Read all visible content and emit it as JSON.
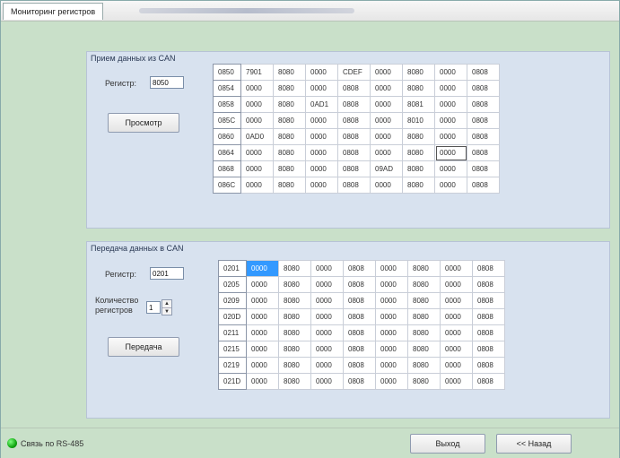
{
  "window": {
    "title": "Мониторинг регистров"
  },
  "receive": {
    "caption": "Прием данных из CAN",
    "register_label": "Регистр:",
    "register_value": "8050",
    "view_button": "Просмотр",
    "rows": [
      {
        "addr": "0850",
        "cells": [
          "7901",
          "8080",
          "0000",
          "CDEF",
          "0000",
          "8080",
          "0000",
          "0808"
        ]
      },
      {
        "addr": "0854",
        "cells": [
          "0000",
          "8080",
          "0000",
          "0808",
          "0000",
          "8080",
          "0000",
          "0808"
        ]
      },
      {
        "addr": "0858",
        "cells": [
          "0000",
          "8080",
          "0AD1",
          "0808",
          "0000",
          "8081",
          "0000",
          "0808"
        ]
      },
      {
        "addr": "085C",
        "cells": [
          "0000",
          "8080",
          "0000",
          "0808",
          "0000",
          "8010",
          "0000",
          "0808"
        ]
      },
      {
        "addr": "0860",
        "cells": [
          "0AD0",
          "8080",
          "0000",
          "0808",
          "0000",
          "8080",
          "0000",
          "0808"
        ]
      },
      {
        "addr": "0864",
        "cells": [
          "0000",
          "8080",
          "0000",
          "0808",
          "0000",
          "8080",
          "0000",
          "0808"
        ]
      },
      {
        "addr": "0868",
        "cells": [
          "0000",
          "8080",
          "0000",
          "0808",
          "09AD",
          "8080",
          "0000",
          "0808"
        ]
      },
      {
        "addr": "086C",
        "cells": [
          "0000",
          "8080",
          "0000",
          "0808",
          "0000",
          "8080",
          "0000",
          "0808"
        ]
      }
    ]
  },
  "transmit": {
    "caption": "Передача данных в CAN",
    "register_label": "Регистр:",
    "register_value": "0201",
    "count_label_1": "Количество",
    "count_label_2": "регистров",
    "count_value": "1",
    "send_button": "Передача",
    "rows": [
      {
        "addr": "0201",
        "cells": [
          "0000",
          "8080",
          "0000",
          "0808",
          "0000",
          "8080",
          "0000",
          "0808"
        ]
      },
      {
        "addr": "0205",
        "cells": [
          "0000",
          "8080",
          "0000",
          "0808",
          "0000",
          "8080",
          "0000",
          "0808"
        ]
      },
      {
        "addr": "0209",
        "cells": [
          "0000",
          "8080",
          "0000",
          "0808",
          "0000",
          "8080",
          "0000",
          "0808"
        ]
      },
      {
        "addr": "020D",
        "cells": [
          "0000",
          "8080",
          "0000",
          "0808",
          "0000",
          "8080",
          "0000",
          "0808"
        ]
      },
      {
        "addr": "0211",
        "cells": [
          "0000",
          "8080",
          "0000",
          "0808",
          "0000",
          "8080",
          "0000",
          "0808"
        ]
      },
      {
        "addr": "0215",
        "cells": [
          "0000",
          "8080",
          "0000",
          "0808",
          "0000",
          "8080",
          "0000",
          "0808"
        ]
      },
      {
        "addr": "0219",
        "cells": [
          "0000",
          "8080",
          "0000",
          "0808",
          "0000",
          "8080",
          "0000",
          "0808"
        ]
      },
      {
        "addr": "021D",
        "cells": [
          "0000",
          "8080",
          "0000",
          "0808",
          "0000",
          "8080",
          "0000",
          "0808"
        ]
      }
    ]
  },
  "status": {
    "connection_label": "Связь по RS-485",
    "led_color": "#11a611"
  },
  "footer": {
    "exit_button": "Выход",
    "back_button": "<< Назад"
  }
}
